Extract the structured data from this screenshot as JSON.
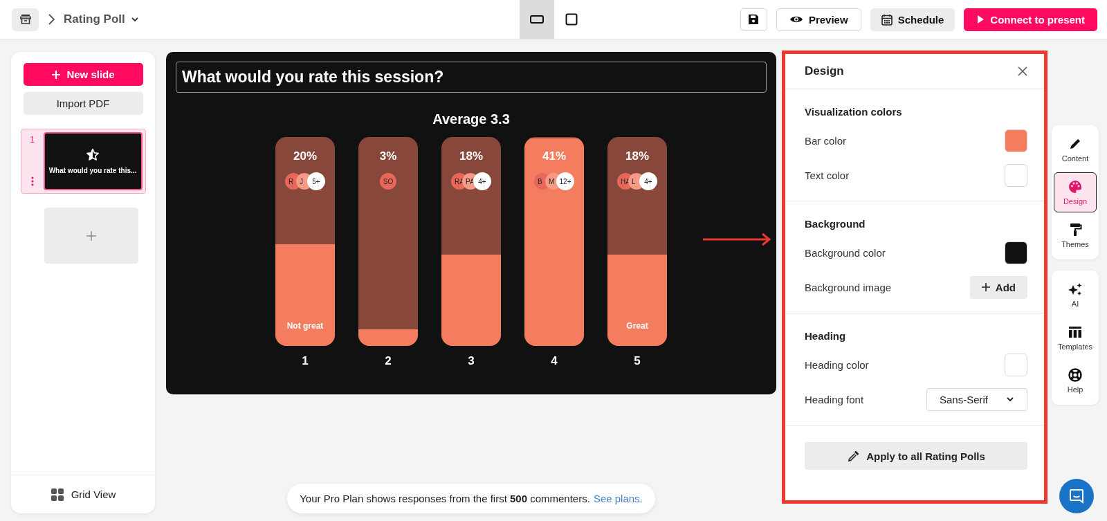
{
  "topbar": {
    "breadcrumb": "Rating Poll",
    "view_toggles": [
      {
        "kind": "wide",
        "selected": true
      },
      {
        "kind": "square",
        "selected": false
      }
    ],
    "buttons": [
      {
        "kind": "save"
      },
      {
        "kind": "preview",
        "label": "Preview"
      },
      {
        "kind": "schedule",
        "label": "Schedule"
      },
      {
        "kind": "present",
        "label": "Connect to present"
      }
    ]
  },
  "sidebar": {
    "new_slide": "New slide",
    "import": "Import PDF",
    "slides": [
      {
        "number": "1",
        "title": "What would you rate this...",
        "selected": true
      }
    ],
    "grid_view": "Grid View"
  },
  "slide": {
    "heading": "What would you rate this session?",
    "average": "Average 3.3",
    "bars": [
      {
        "percent": "20%",
        "level": 0.49,
        "label": "Not great",
        "number": "1",
        "avatars": [
          {
            "kind": "initials",
            "text": "R",
            "color": "#e8675a"
          },
          {
            "kind": "initials",
            "text": "J",
            "color": "#f59a86"
          },
          {
            "kind": "count",
            "text": "5+"
          }
        ]
      },
      {
        "percent": "3%",
        "level": 0.08,
        "number": "2",
        "avatars": [
          {
            "kind": "initials",
            "text": "SO",
            "color": "#e8675a"
          }
        ]
      },
      {
        "percent": "18%",
        "level": 0.44,
        "number": "3",
        "avatars": [
          {
            "kind": "initials",
            "text": "RA",
            "color": "#e8675a"
          },
          {
            "kind": "initials",
            "text": "PA",
            "color": "#f59a86"
          },
          {
            "kind": "count",
            "text": "4+"
          }
        ]
      },
      {
        "percent": "41%",
        "level": 1,
        "number": "4",
        "avatars": [
          {
            "kind": "initials",
            "text": "B",
            "color": "#e8675a"
          },
          {
            "kind": "initials",
            "text": "M",
            "color": "#f59a86"
          },
          {
            "kind": "count",
            "text": "12+"
          }
        ]
      },
      {
        "percent": "18%",
        "level": 0.44,
        "label": "Great",
        "number": "5",
        "avatars": [
          {
            "kind": "initials",
            "text": "HA",
            "color": "#e8675a"
          },
          {
            "kind": "initials",
            "text": "L",
            "color": "#f59a86"
          },
          {
            "kind": "count",
            "text": "4+"
          }
        ]
      }
    ]
  },
  "notice": {
    "text": "Your Pro Plan shows responses from the first **500** commenters.",
    "link": "See plans."
  },
  "design_panel": {
    "title": "Design",
    "sections": [
      {
        "title": "Visualization colors",
        "rows": [
          {
            "kind": "swatch",
            "label": "Bar color",
            "color": "#f47c5f"
          },
          {
            "kind": "swatch",
            "label": "Text color",
            "color": "#ffffff"
          }
        ]
      },
      {
        "title": "Background",
        "rows": [
          {
            "kind": "swatch",
            "label": "Background color",
            "color": "#111111"
          },
          {
            "kind": "add",
            "label": "Background image",
            "button": "Add"
          }
        ]
      },
      {
        "title": "Heading",
        "rows": [
          {
            "kind": "swatch",
            "label": "Heading color",
            "color": "#ffffff"
          },
          {
            "kind": "select",
            "label": "Heading font",
            "value": "Sans-Serif"
          }
        ]
      }
    ],
    "apply_button": "Apply to all Rating Polls"
  },
  "toolbar": [
    [
      {
        "kind": "content",
        "label": "Content",
        "selected": false
      },
      {
        "kind": "design",
        "label": "Design",
        "selected": true
      },
      {
        "kind": "themes",
        "label": "Themes",
        "selected": false
      }
    ],
    [
      {
        "kind": "ai",
        "label": "AI",
        "selected": false
      },
      {
        "kind": "templates",
        "label": "Templates",
        "selected": false
      },
      {
        "kind": "help",
        "label": "Help",
        "selected": false
      }
    ]
  ]
}
